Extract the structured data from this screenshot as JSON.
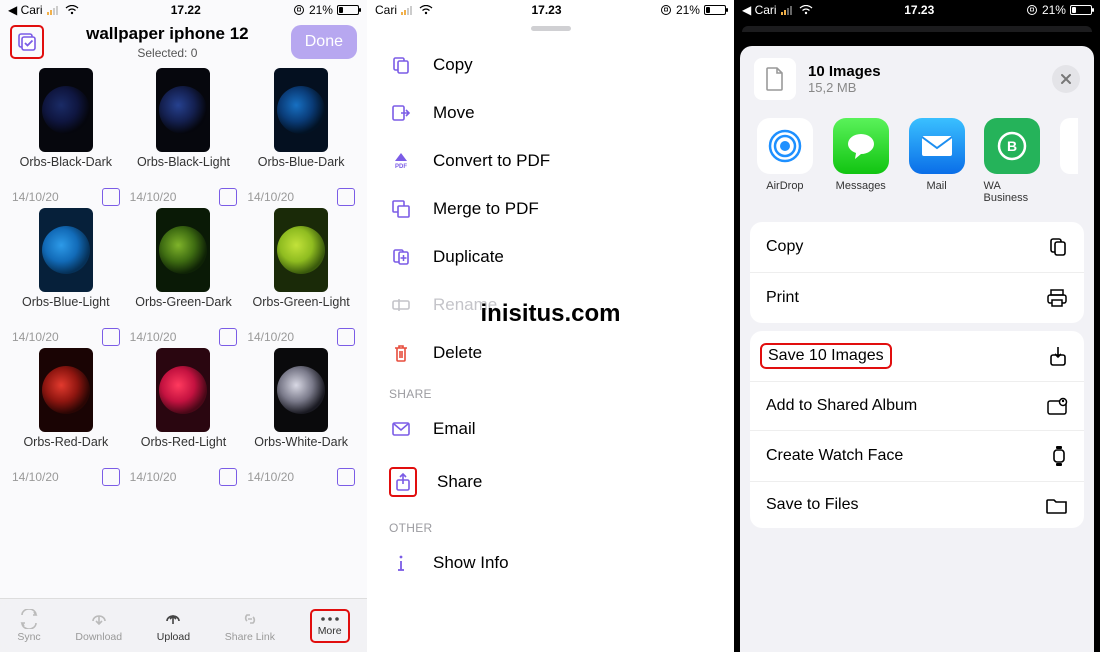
{
  "statusbars": {
    "s1": {
      "carrier": "◀ Cari",
      "time": "17.22",
      "battery": "21%"
    },
    "s2": {
      "carrier": "Cari",
      "time": "17.23",
      "battery": "21%"
    },
    "s3": {
      "carrier": "◀ Cari",
      "time": "17.23",
      "battery": "21%"
    }
  },
  "pane1": {
    "title": "wallpaper iphone 12",
    "subtitle": "Selected: 0",
    "done": "Done",
    "files": [
      {
        "name": "Orbs-Black-Dark",
        "date": "14/10/20",
        "bg": "#06070d",
        "grad": "radial-gradient(circle at 40% 40%, #1a2b66, #0f1640 40%, #05060d 70%)"
      },
      {
        "name": "Orbs-Black-Light",
        "date": "14/10/20",
        "bg": "#06070d",
        "grad": "radial-gradient(circle at 40% 40%, #26418f, #142050 40%, #05060d 70%)"
      },
      {
        "name": "Orbs-Blue-Dark",
        "date": "14/10/20",
        "bg": "#041020",
        "grad": "radial-gradient(circle at 40% 40%, #1770c2, #0a3c78 40%, #021224 70%)"
      },
      {
        "name": "Orbs-Blue-Light",
        "date": "14/10/20",
        "bg": "#06203a",
        "grad": "radial-gradient(circle at 40% 40%, #2d9ae8, #126bb8 40%, #063158 70%)"
      },
      {
        "name": "Orbs-Green-Dark",
        "date": "14/10/20",
        "bg": "#0a1a06",
        "grad": "radial-gradient(circle at 40% 40%, #7fb32a, #3f6d12 40%, #0f2306 70%)"
      },
      {
        "name": "Orbs-Green-Light",
        "date": "14/10/20",
        "bg": "#1a2a08",
        "grad": "radial-gradient(circle at 40% 40%, #c2e23a, #8fbc20 40%, #3a5a0c 70%)"
      },
      {
        "name": "Orbs-Red-Dark",
        "date": "14/10/20",
        "bg": "#1a0404",
        "grad": "radial-gradient(circle at 40% 40%, #e23a2e, #8f1610 40%, #2a0604 70%)"
      },
      {
        "name": "Orbs-Red-Light",
        "date": "14/10/20",
        "bg": "#2a0610",
        "grad": "radial-gradient(circle at 40% 40%, #ff3a5e, #c41240 40%, #4a0818 70%)"
      },
      {
        "name": "Orbs-White-Dark",
        "date": "14/10/20",
        "bg": "#0a0a0c",
        "grad": "radial-gradient(circle at 40% 40%, #d8d8e4, #7a7a8a 40%, #1a1a22 70%)"
      }
    ],
    "toolbar": {
      "sync": "Sync",
      "download": "Download",
      "upload": "Upload",
      "shareLink": "Share Link",
      "more": "More"
    }
  },
  "pane2": {
    "items": {
      "copy": "Copy",
      "move": "Move",
      "pdf": "Convert to PDF",
      "merge": "Merge to PDF",
      "duplicate": "Duplicate",
      "rename": "Rename",
      "delete": "Delete",
      "email": "Email",
      "share": "Share",
      "info": "Show Info"
    },
    "sections": {
      "share": "SHARE",
      "other": "OTHER"
    },
    "watermark": "inisitus.com"
  },
  "pane3": {
    "title": "10 Images",
    "subtitle": "15,2 MB",
    "apps": {
      "airdrop": "AirDrop",
      "messages": "Messages",
      "mail": "Mail",
      "wa": "WA Business"
    },
    "actions": {
      "copy": "Copy",
      "print": "Print",
      "save": "Save 10 Images",
      "album": "Add to Shared Album",
      "watch": "Create Watch Face",
      "files": "Save to Files"
    }
  }
}
